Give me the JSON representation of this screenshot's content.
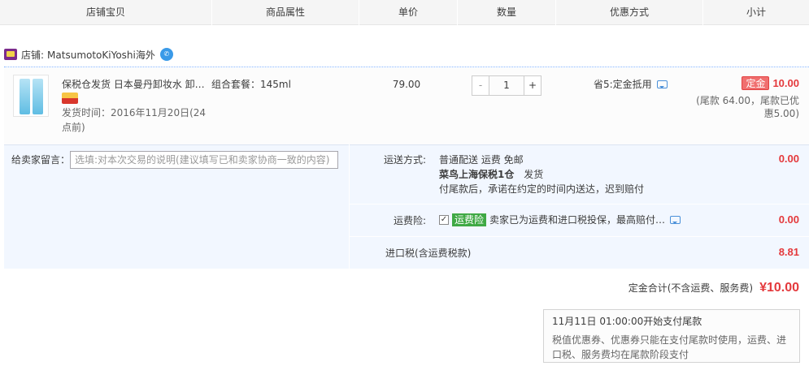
{
  "columns": [
    "店铺宝贝",
    "商品属性",
    "单价",
    "数量",
    "优惠方式",
    "小计"
  ],
  "shop": {
    "label": "店铺:",
    "name": "MatsumotoKiYoshi海外"
  },
  "item": {
    "title": "保税仓发货 日本曼丹卸妆水 卸…",
    "ship_time": "发货时间：2016年11月20日(24点前)",
    "attribute": "组合套餐：145ml",
    "price": "79.00",
    "quantity": "1",
    "qty_minus": "-",
    "qty_plus": "+",
    "discount": "省5:定金抵用",
    "deposit_tag": "定金",
    "subtotal": "10.00",
    "subtotal_note": "(尾款 64.00，尾款已优惠5.00)"
  },
  "message": {
    "label": "给卖家留言：",
    "placeholder": "选填:对本次交易的说明(建议填写已和卖家协商一致的内容)"
  },
  "shipping": {
    "label": "运送方式:",
    "method": "普通配送 运费 免邮",
    "warehouse": "菜鸟上海保税1仓",
    "warehouse_suffix": "发货",
    "promise": "付尾款后，承诺在约定的时间内送达，迟到赔付",
    "amount": "0.00"
  },
  "insurance": {
    "label": "运费险:",
    "check": "✓",
    "badge": "运费险",
    "text": "卖家已为运费和进口税投保，最高赔付…",
    "amount": "0.00"
  },
  "import_tax": {
    "label": "进口税(含运费税款)",
    "amount": "8.81"
  },
  "total": {
    "label": "定金合计(不含运费、服务费)",
    "value": "¥10.00"
  },
  "notice": {
    "title": "11月11日 01:00:00开始支付尾款",
    "body": "税值优惠券、优惠券只能在支付尾款时使用，运费、进口税、服务费均在尾款阶段支付"
  },
  "colors": {
    "accent_red": "#e4393c",
    "insurance_green": "#3fa944",
    "panel_blue": "#f2f7ff"
  }
}
